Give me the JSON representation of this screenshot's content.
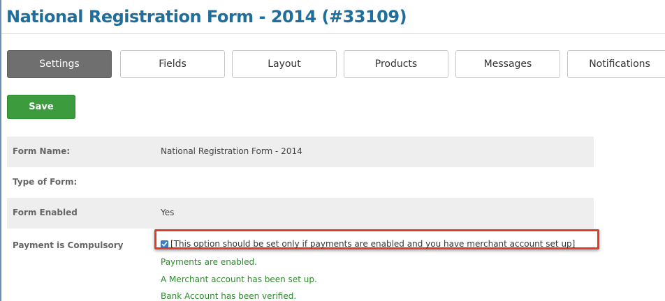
{
  "page": {
    "title": "National Registration Form - 2014 (#33109)"
  },
  "tabs": [
    {
      "label": "Settings",
      "active": true
    },
    {
      "label": "Fields",
      "active": false
    },
    {
      "label": "Layout",
      "active": false
    },
    {
      "label": "Products",
      "active": false
    },
    {
      "label": "Messages",
      "active": false
    },
    {
      "label": "Notifications",
      "active": false
    }
  ],
  "toolbar": {
    "save_label": "Save"
  },
  "settings": {
    "form_name": {
      "label": "Form Name:",
      "value": "National Registration Form - 2014"
    },
    "type_of_form": {
      "label": "Type of Form:",
      "value": ""
    },
    "form_enabled": {
      "label": "Form Enabled",
      "value": "Yes"
    },
    "payment": {
      "label": "Payment is Compulsory",
      "checked": true,
      "checkbox_text": "[This option should be set only if payments are enabled and you have merchant account set up]",
      "status": [
        "Payments are enabled.",
        "A Merchant account has been set up.",
        "Bank Account has been verified."
      ]
    }
  },
  "colors": {
    "title": "#1f6e9c",
    "active_tab": "#6f6f6f",
    "save_button": "#3c9b3c",
    "highlight": "#e23c26",
    "status_text": "#2b8a2b"
  }
}
